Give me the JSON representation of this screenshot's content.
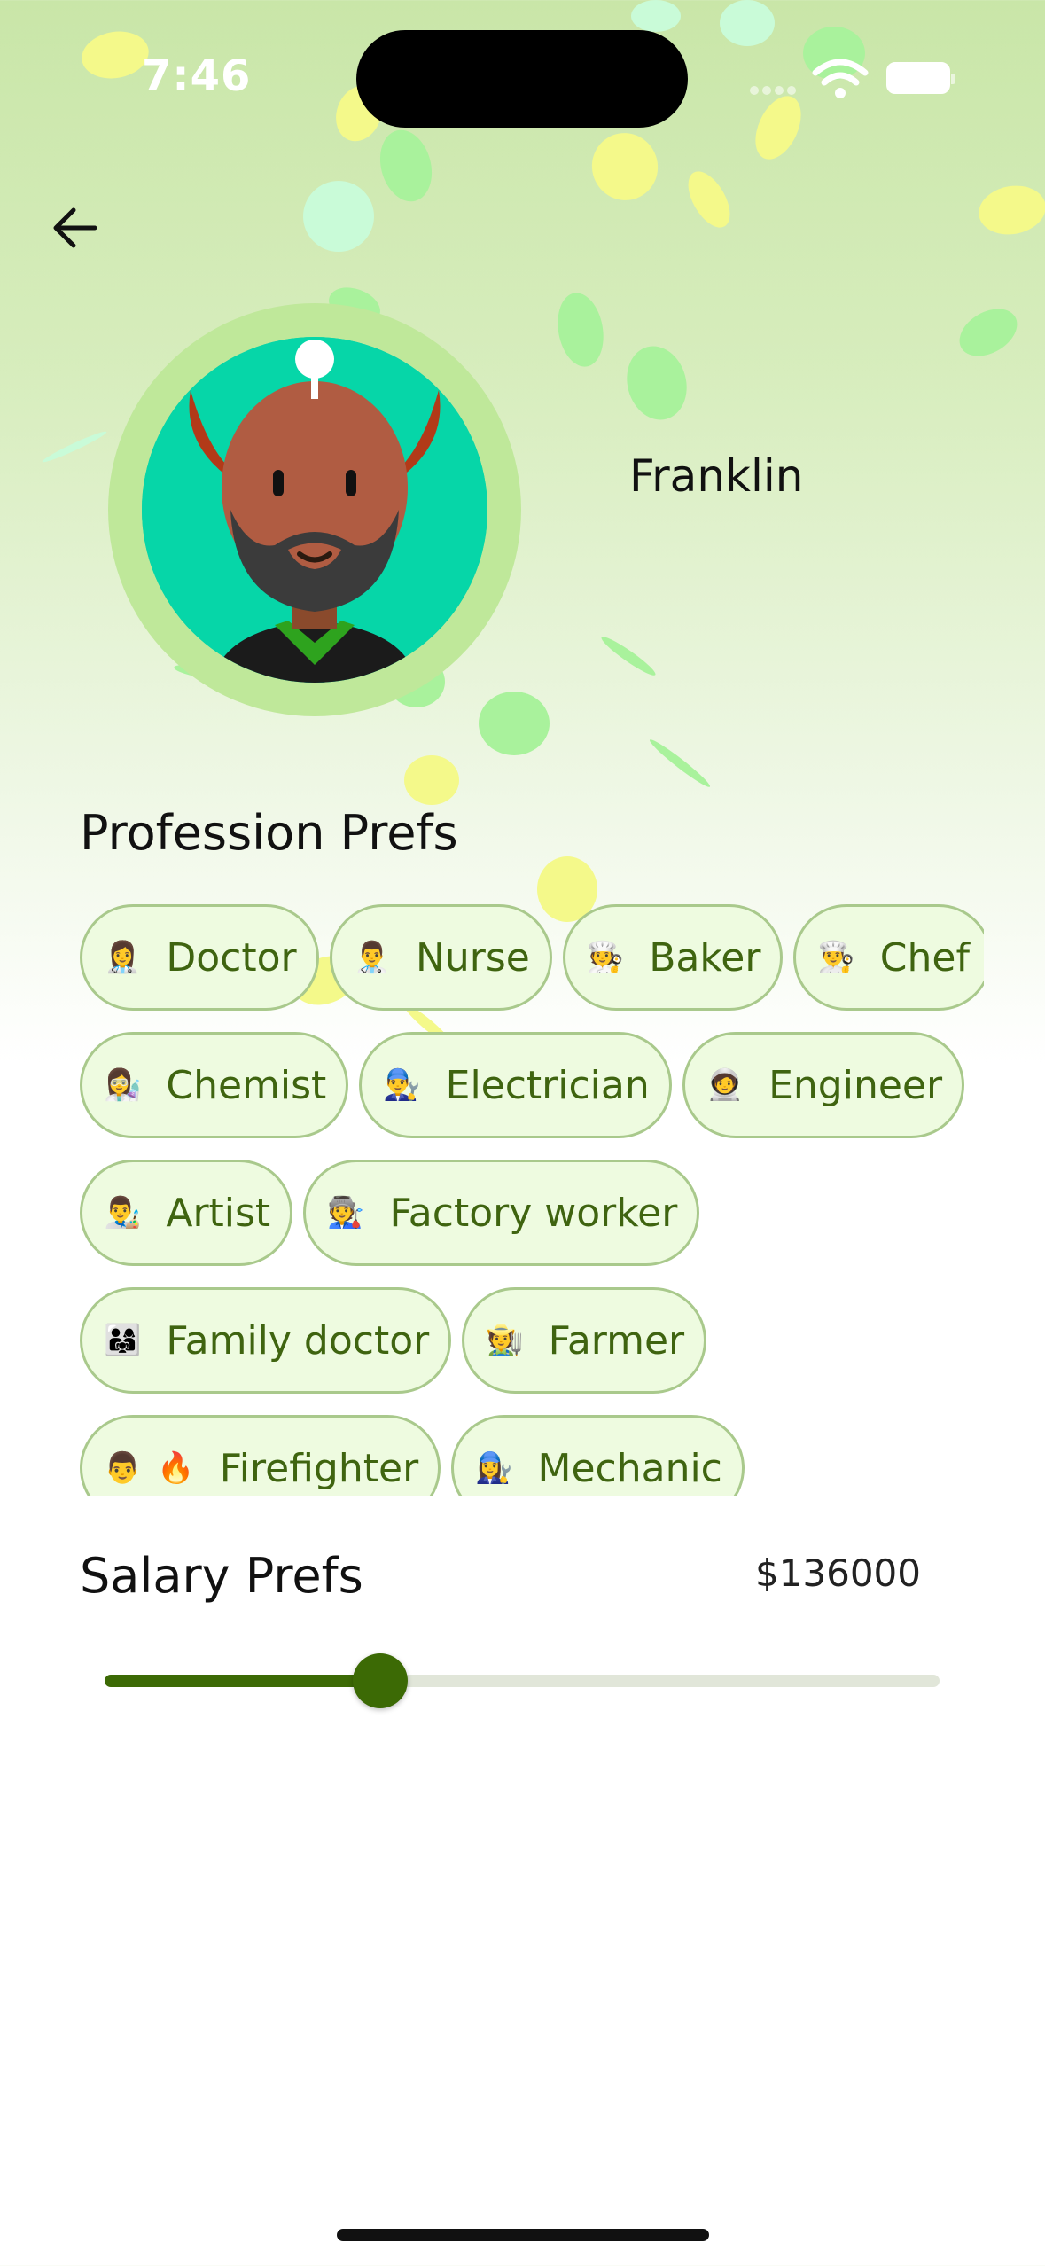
{
  "status_bar": {
    "time": "7:46"
  },
  "header": {
    "back_icon": "arrow-left-icon"
  },
  "profile": {
    "name": "Franklin",
    "avatar_icon": "bearded-man-avatar-icon"
  },
  "profession_prefs": {
    "title": "Profession Prefs",
    "rows": [
      [
        {
          "emoji": "👩‍⚕️",
          "label": "Doctor"
        },
        {
          "emoji": "👨‍⚕️",
          "label": "Nurse"
        },
        {
          "emoji": "🧑‍🍳",
          "label": "Baker"
        },
        {
          "emoji": "👨‍🍳",
          "label": "Chef"
        }
      ],
      [
        {
          "emoji": "👩‍🔬",
          "label": "Chemist"
        },
        {
          "emoji": "👨‍🔧",
          "label": "Electrician"
        },
        {
          "emoji": "🧑‍🚀",
          "label": "Engineer"
        }
      ],
      [
        {
          "emoji": "👨‍🎨",
          "label": "Artist"
        },
        {
          "emoji": "🧑‍🏭",
          "label": "Factory worker"
        }
      ],
      [
        {
          "emoji": "👨‍👩‍👧",
          "label": "Family doctor"
        },
        {
          "emoji": "🧑‍🌾",
          "label": "Farmer"
        }
      ],
      [
        {
          "emoji": "👨",
          "emoji2": "🔥",
          "label": "Firefighter"
        },
        {
          "emoji": "👩‍🔧",
          "label": "Mechanic"
        }
      ]
    ]
  },
  "salary_prefs": {
    "title": "Salary Prefs",
    "value_label": "$136000",
    "slider_fraction": 0.33
  },
  "colors": {
    "accent": "#3c6a05",
    "chip_bg": "#eefbe0",
    "chip_border": "#a9c98c",
    "chip_text": "#3f6410",
    "avatar_bg": "#06d6a8"
  }
}
